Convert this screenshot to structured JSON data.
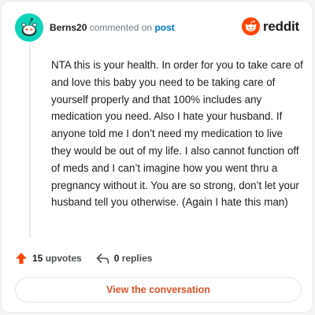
{
  "header": {
    "username": "Berns20",
    "action_text": "commented on",
    "post_link": "post",
    "brand_name": "reddit"
  },
  "comment": {
    "body": "NTA this is your health. In order for you to take care of and love this baby you need to be taking care of yourself properly and that 100% includes any medication you need. Also I hate your husband. If anyone told me I don’t need my medication to live they would be out of my life. I also cannot function off of meds and I can’t imagine how you went thru a pregnancy without it. You are so strong, don’t let your husband tell you otherwise. (Again I hate this man)"
  },
  "footer": {
    "upvotes_count": "15",
    "upvotes_label": "upvotes",
    "replies_count": "0",
    "replies_label": "replies",
    "upvote_icon": "upvote-arrow-icon",
    "reply_icon": "reply-arrow-icon"
  },
  "cta": {
    "view_label": "View the conversation"
  },
  "colors": {
    "brand_orange": "#ff4500",
    "avatar_teal": "#0dd3bb",
    "link_blue": "#0079d3",
    "cta_text": "#e0512b"
  }
}
